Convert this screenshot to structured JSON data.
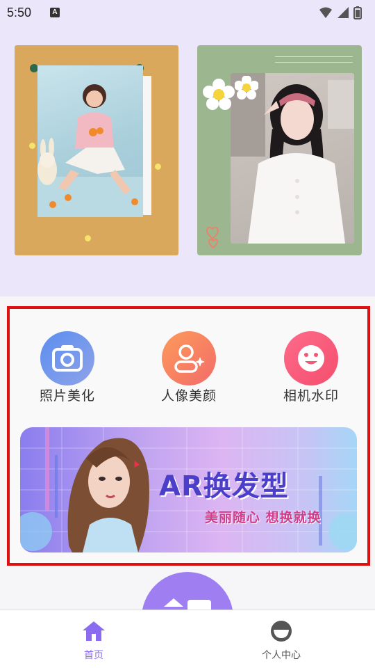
{
  "status_bar": {
    "time": "5:50",
    "notification_icon": "A"
  },
  "banner": {
    "images": [
      {
        "name": "photo-card-girl-with-oranges"
      },
      {
        "name": "photo-card-girl-with-braids"
      }
    ]
  },
  "features": [
    {
      "label": "照片美化",
      "icon": "camera-icon",
      "color": "#6c8de6"
    },
    {
      "label": "人像美颜",
      "icon": "portrait-icon",
      "color": "#fa7a5a"
    },
    {
      "label": "相机水印",
      "icon": "smile-icon",
      "color": "#f65a7c"
    }
  ],
  "ar_banner": {
    "title": "AR换发型",
    "subtitle": "美丽随心  想换就换"
  },
  "bottom_nav": {
    "items": [
      {
        "label": "首页",
        "icon": "home-icon",
        "active": true,
        "color": "#8b6cf0"
      },
      {
        "label": "个人中心",
        "icon": "profile-icon",
        "active": false,
        "color": "#555555"
      }
    ]
  },
  "colors": {
    "accent": "#8b6cf0",
    "highlight_border": "#e01010",
    "banner_bg": "#ece6fb"
  }
}
